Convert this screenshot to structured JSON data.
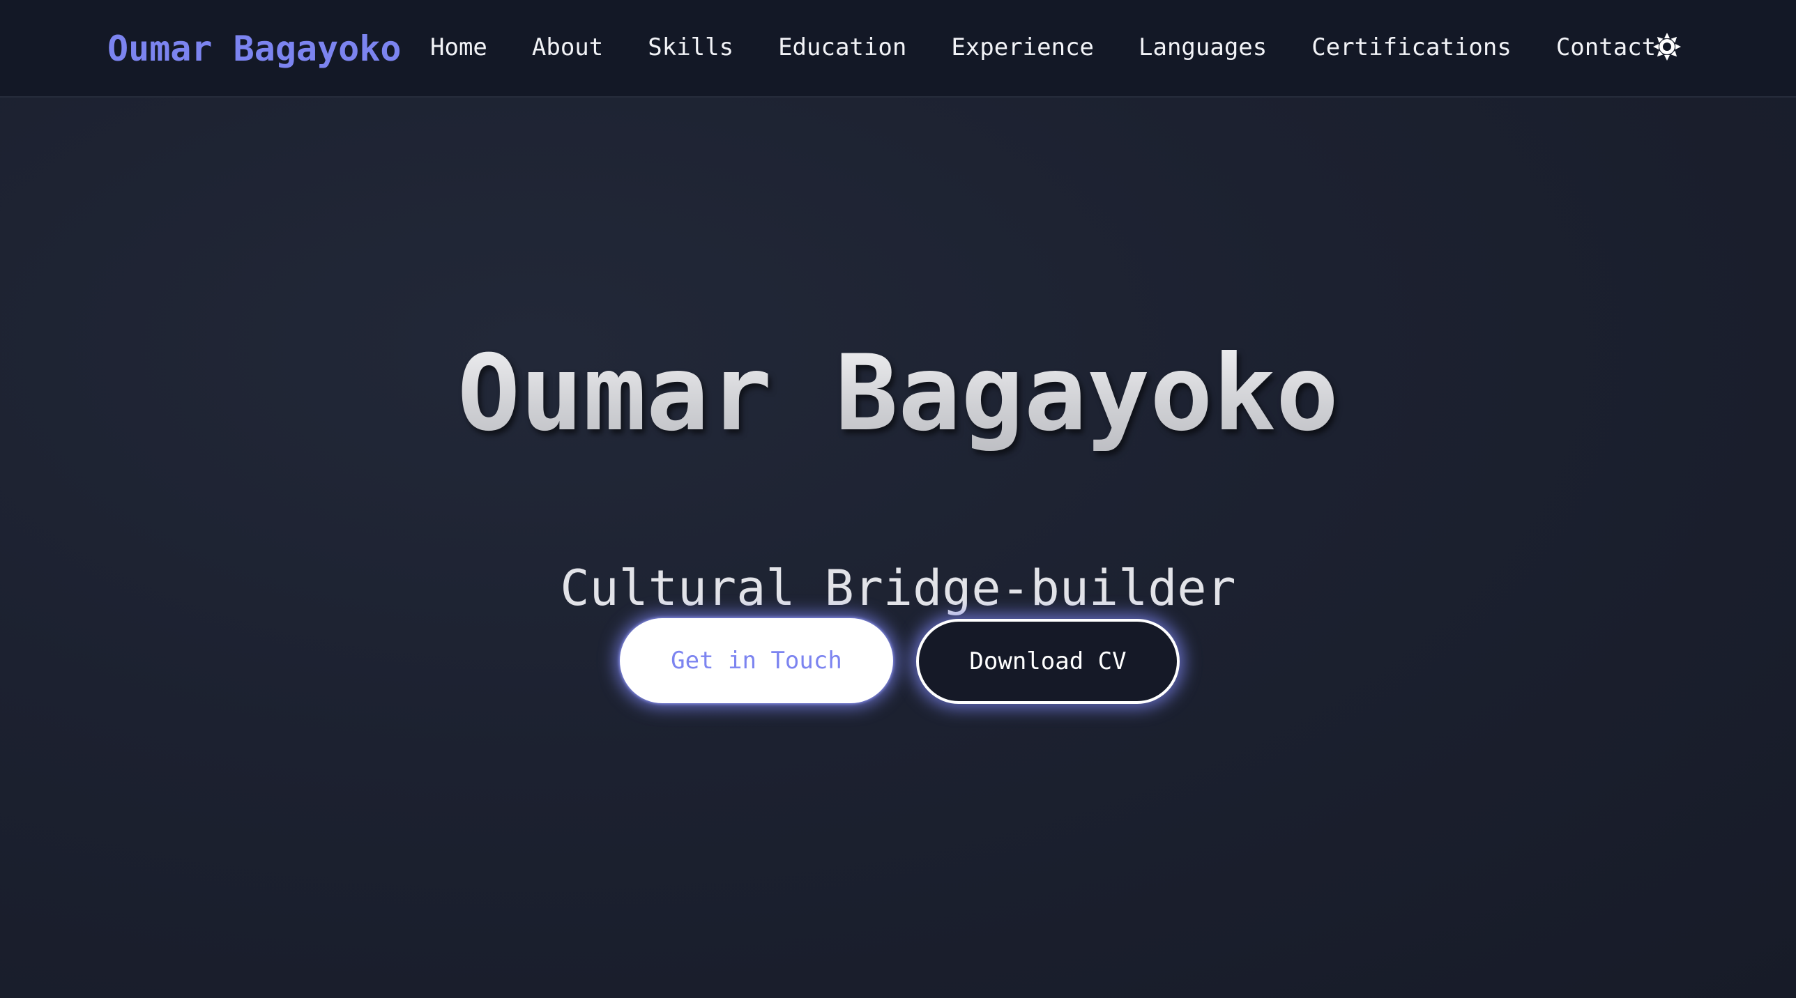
{
  "navbar": {
    "brand": "Oumar Bagayoko",
    "links": [
      {
        "label": "Home"
      },
      {
        "label": "About"
      },
      {
        "label": "Skills"
      },
      {
        "label": "Education"
      },
      {
        "label": "Experience"
      },
      {
        "label": "Languages"
      },
      {
        "label": "Certifications"
      },
      {
        "label": "Contact"
      }
    ],
    "theme_toggle_icon": "sun-icon"
  },
  "hero": {
    "title": "Oumar Bagayoko",
    "subtitle": "Cultural Bridge-builder",
    "primary_button": "Get in Touch",
    "secondary_button": "Download CV"
  },
  "colors": {
    "accent": "#7c84f0",
    "background": "#1b2030",
    "navbar_background": "#131826",
    "text": "#f2f3f7"
  }
}
